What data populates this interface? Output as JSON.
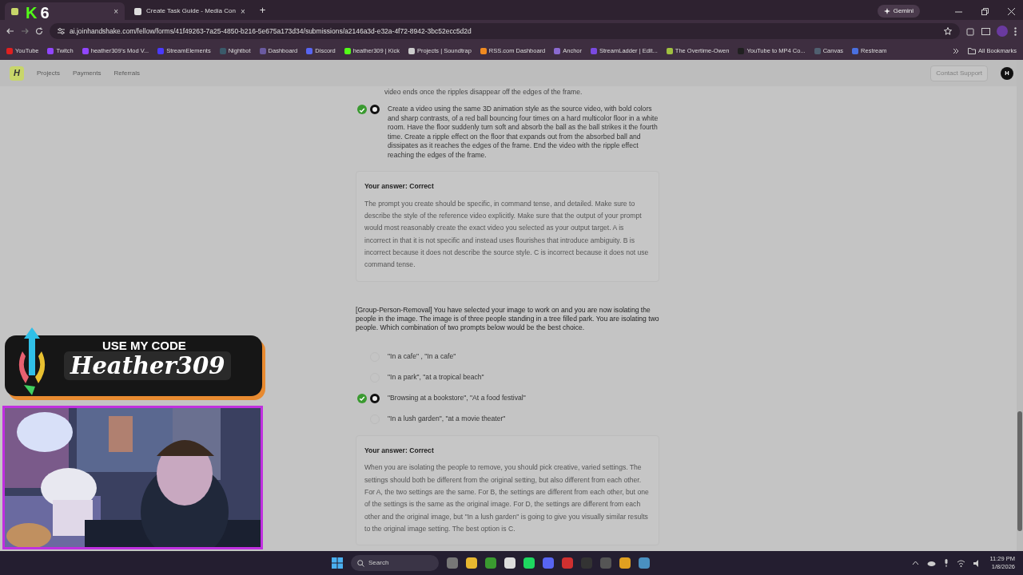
{
  "browser": {
    "tabs": [
      {
        "close": "×",
        "selected": true
      },
      {
        "title": "Create Task Guide - Media Con",
        "close": "×",
        "selected": false
      }
    ],
    "new_tab": "+",
    "gemini": "Gemini",
    "url": "ai.joinhandshake.com/fellow/forms/41f49263-7a25-4850-b216-5e675a173d34/submissions/a2146a3d-e32a-4f72-8942-3bc52ecc5d2d",
    "bookmarks": [
      {
        "label": "YouTube",
        "color": "#e02020"
      },
      {
        "label": "Twitch",
        "color": "#9146ff"
      },
      {
        "label": "heather309's Mod V...",
        "color": "#9146ff"
      },
      {
        "label": "StreamElements",
        "color": "#4a3aff"
      },
      {
        "label": "Nightbot",
        "color": "#3a5a6a"
      },
      {
        "label": "Dashboard",
        "color": "#6a5aa0"
      },
      {
        "label": "Discord",
        "color": "#5865f2"
      },
      {
        "label": "heather309 | Kick",
        "color": "#53fc18"
      },
      {
        "label": "Projects | Soundtrap",
        "color": "#cccccc"
      },
      {
        "label": "RSS.com Dashboard",
        "color": "#f08a20"
      },
      {
        "label": "Anchor",
        "color": "#8a6ad0"
      },
      {
        "label": "StreamLadder | Edit...",
        "color": "#7a4ae0"
      },
      {
        "label": "The Overtime-Owen",
        "color": "#a0c040"
      },
      {
        "label": "YouTube to MP4 Co...",
        "color": "#202020"
      },
      {
        "label": "Canvas",
        "color": "#506070"
      },
      {
        "label": "Restream",
        "color": "#4a70e0"
      }
    ],
    "all_bookmarks": "All Bookmarks"
  },
  "site": {
    "logo": "H",
    "nav": [
      "Projects",
      "Payments",
      "Referrals"
    ],
    "contact": "Contact Support",
    "avatar": "H"
  },
  "questions": [
    {
      "prompt_tail": "video ends once the ripples disappear off the edges of the frame.",
      "options": [
        {
          "text": "Create a video using the same 3D animation style as the source video, with bold colors and sharp contrasts, of a red ball bouncing four times on a hard multicolor floor in a white room. Have the floor suddenly turn soft and absorb the ball as the ball strikes it the fourth time. Create a ripple effect on the floor that expands out from the absorbed ball and dissipates as it reaches the edges of the frame. End the video with the ripple effect reaching the edges of the frame.",
          "selected": true,
          "correct": true
        }
      ],
      "feedback": {
        "heading": "Your answer: Correct",
        "text": "The prompt you create should be specific, in command tense, and detailed. Make sure to describe the style of the reference video explicitly. Make sure that the output of your prompt would most reasonably create the exact video you selected as your output target. A is incorrect in that it is not specific and instead uses flourishes that introduce ambiguity. B is incorrect because it does not describe the source style. C is incorrect because it does not use command tense."
      }
    },
    {
      "prompt": "[Group-Person-Removal] You have selected your image to work on and you are now isolating the people in the image. The image is of three people standing in a tree filled park. You are isolating two people. Which combination of two prompts below would be the best choice.",
      "options": [
        {
          "text": "\"In a cafe\" , \"In a cafe\"",
          "selected": false,
          "correct": false
        },
        {
          "text": "\"In a park\", \"at a tropical beach\"",
          "selected": false,
          "correct": false
        },
        {
          "text": "\"Browsing at a bookstore\", \"At a food festival\"",
          "selected": true,
          "correct": true
        },
        {
          "text": "\"In a lush garden\", \"at a movie theater\"",
          "selected": false,
          "correct": false
        }
      ],
      "feedback": {
        "heading": "Your answer: Correct",
        "text": "When you are isolating the people to remove, you should pick creative, varied settings. The settings should both be different from the original setting, but also different from each other. For A, the two settings are the same. For B, the settings are different from each other, but one of the settings is the same as the original image. For D, the settings are different from each other and the original image, but \"In a lush garden\" is going to give you visually similar results to the original image setting. The best option is C."
      }
    }
  ],
  "overlay": {
    "badge": [
      "K",
      "6"
    ],
    "promo_heading": "USE MY CODE",
    "promo_code": "Heather309",
    "webcam": {
      "kind": "picture"
    }
  },
  "taskbar": {
    "search": "Search",
    "time": "11:29 PM",
    "date": "1/8/2026"
  }
}
